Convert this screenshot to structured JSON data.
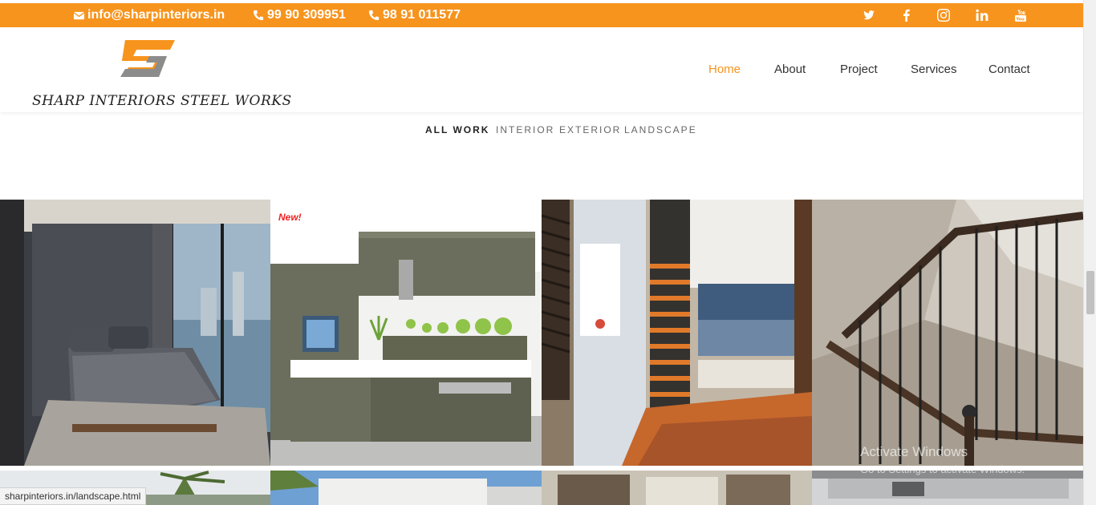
{
  "topbar": {
    "email": "info@sharpinteriors.in",
    "phone1": "99 90 309951",
    "phone2": "98 91 011577",
    "accent_color": "#f7941d",
    "social_icons": [
      "twitter-icon",
      "facebook-icon",
      "instagram-icon",
      "linkedin-icon",
      "youtube-icon"
    ]
  },
  "header": {
    "brand": "SHARP INTERIORS STEEL WORKS",
    "nav": [
      {
        "label": "Home",
        "active": true
      },
      {
        "label": "About"
      },
      {
        "label": "Project"
      },
      {
        "label": "Services"
      },
      {
        "label": "Contact"
      }
    ]
  },
  "filters": [
    {
      "label": "ALL WORK",
      "active": true
    },
    {
      "label": "INTERIOR"
    },
    {
      "label": "EXTERIOR"
    },
    {
      "label": "LANDSCAPE"
    }
  ],
  "gallery": {
    "badge": "New!",
    "tiles": [
      "bedroom",
      "kitchen",
      "staircase-wood",
      "staircase-railing",
      "landscape-palm",
      "exterior-building",
      "exterior-facade",
      "exterior-balcony"
    ]
  },
  "watermark": {
    "line1": "Activate Windows",
    "line2": "Go to Settings to activate Windows."
  },
  "status_url": "sharpinteriors.in/landscape.html"
}
